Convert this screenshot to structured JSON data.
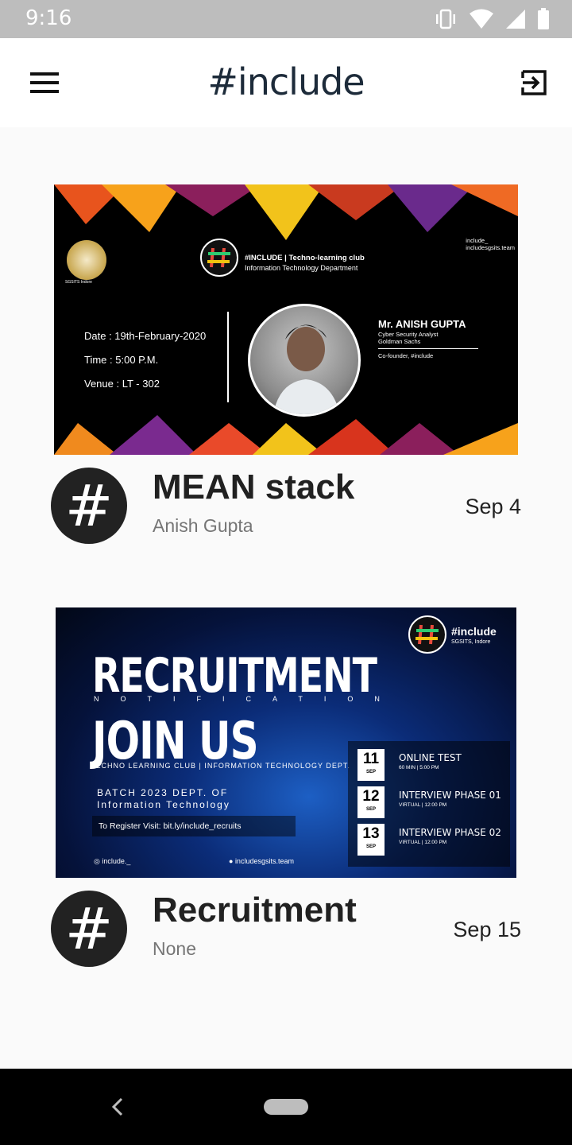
{
  "status_bar": {
    "time": "9:16",
    "icons": [
      "vibrate-icon",
      "wifi-icon",
      "signal-icon",
      "battery-icon"
    ]
  },
  "app_bar": {
    "title": "#include",
    "menu_icon": "hamburger-icon",
    "action_icon": "logout-icon"
  },
  "posts": [
    {
      "title": "MEAN stack",
      "author": "Anish Gupta",
      "date": "Sep 4",
      "avatar_text": "#",
      "banner": {
        "club_line1": "#INCLUDE | Techno-learning club",
        "club_line2": "Information Technology Department",
        "seal_label": "SGSITS Indore",
        "instagram": "include_",
        "website": "includesgsits.team",
        "date_line": "Date : 19th-February-2020",
        "time_line": "Time : 5:00 P.M.",
        "venue_line": "Venue : LT - 302",
        "speaker_name": "Mr. ANISH GUPTA",
        "speaker_role1": "Cyber Security Analyst",
        "speaker_role2": "Goldman Sachs",
        "speaker_role3": "Co-founder, #include"
      }
    },
    {
      "title": "Recruitment",
      "author": "None",
      "date": "Sep 15",
      "avatar_text": "#",
      "banner": {
        "brand": "#include",
        "brand_sub": "SGSITS, Indore",
        "headline1": "RECRUITMENT",
        "notification": "NOTIFICATION",
        "headline2": "JOIN US",
        "dept_line": "TECHNO LEARNING CLUB | INFORMATION TECHNOLOGY DEPT.",
        "batch_line1": "BATCH 2023 DEPT. OF",
        "batch_line2": "Information Technology",
        "register": "To Register Visit: bit.ly/include_recruits",
        "instagram": "include._",
        "website": "includesgsits.team",
        "schedule": [
          {
            "day": "11",
            "month": "SEP",
            "title": "ONLINE TEST",
            "sub": "60 MIN | 5:00 PM"
          },
          {
            "day": "12",
            "month": "SEP",
            "title": "INTERVIEW PHASE 01",
            "sub": "VIRTUAL | 12:00 PM"
          },
          {
            "day": "13",
            "month": "SEP",
            "title": "INTERVIEW PHASE 02",
            "sub": "VIRTUAL | 12:00 PM"
          }
        ]
      }
    }
  ]
}
